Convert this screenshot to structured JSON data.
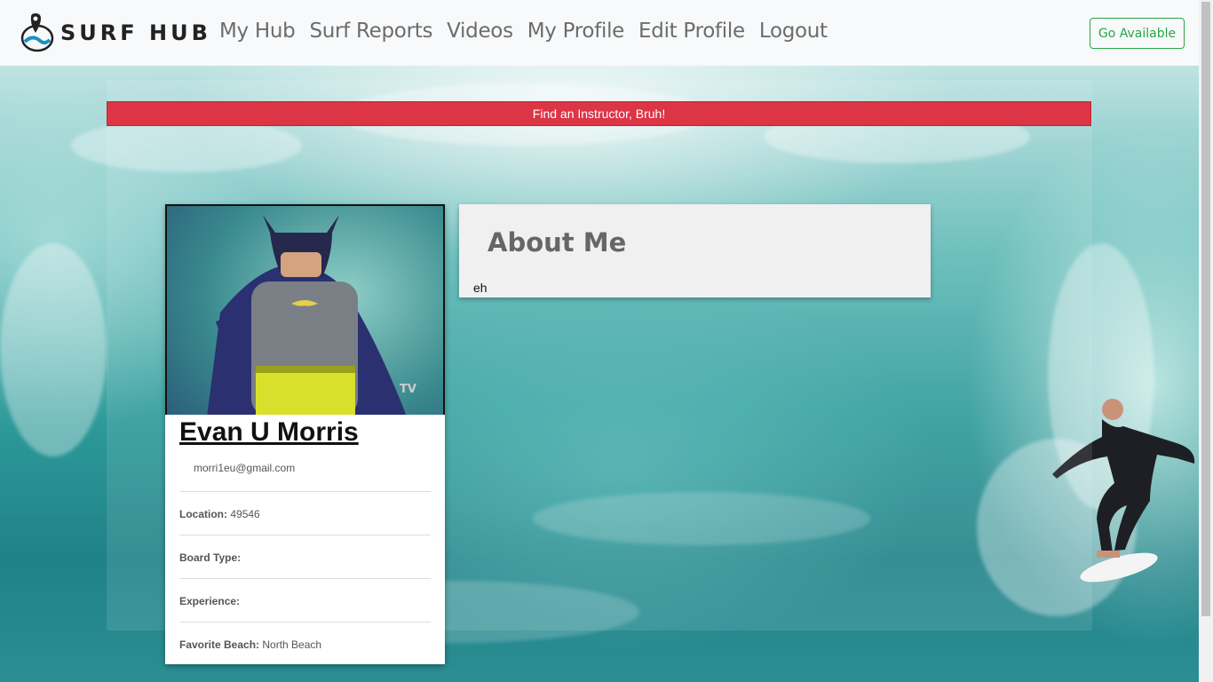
{
  "brand": {
    "name": "SURF HUB"
  },
  "nav": {
    "links": [
      "My Hub",
      "Surf Reports",
      "Videos",
      "My Profile",
      "Edit Profile",
      "Logout"
    ],
    "action_button": "Go Available"
  },
  "banner": {
    "text": "Find an Instructor, Bruh!"
  },
  "profile": {
    "name": "Evan U Morris",
    "email": "morri1eu@gmail.com",
    "location_label": "Location:",
    "location_value": "49546",
    "board_label": "Board Type:",
    "board_value": "",
    "experience_label": "Experience:",
    "experience_value": "",
    "beach_label": "Favorite Beach:",
    "beach_value": "North Beach"
  },
  "about": {
    "title": "About Me",
    "text": "eh"
  },
  "colors": {
    "accent_green": "#28a745",
    "banner_red": "#dc3545"
  }
}
